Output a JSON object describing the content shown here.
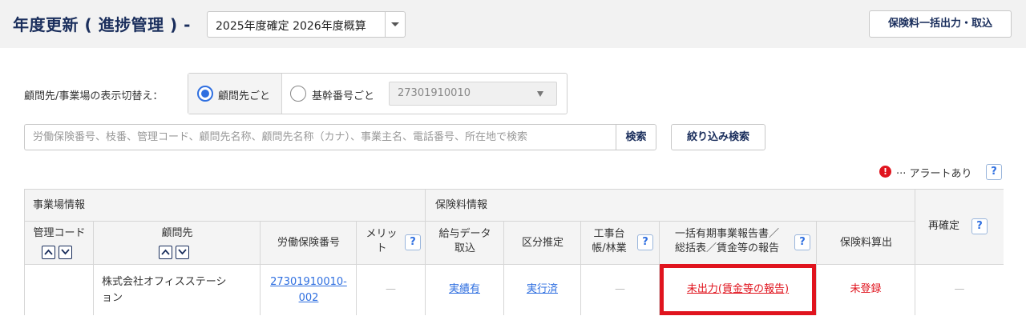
{
  "header": {
    "title": "年度更新 ( 進捗管理 ) -",
    "year_select_value": "2025年度確定 2026年度概算",
    "bulk_button": "保険料一括出力・取込"
  },
  "display_switch": {
    "label": "顧問先/事業場の表示切替え：",
    "option_client": "顧問先ごと",
    "option_base_number": "基幹番号ごと",
    "base_number_value": "27301910010"
  },
  "search": {
    "placeholder": "労働保険番号、枝番、管理コード、顧問先名称、顧問先名称（カナ）、事業主名、電話番号、所在地で検索",
    "search_button": "検索",
    "filter_button": "絞り込み検索"
  },
  "alert_legend": {
    "icon": "!",
    "text": "··· アラートあり",
    "help": "?"
  },
  "table": {
    "group_headers": {
      "office_info": "事業場情報",
      "premium_info": "保険料情報",
      "reconfirm": "再確定"
    },
    "columns": {
      "admin_code": "管理コード",
      "client": "顧問先",
      "labor_insurance_no": "労働保険番号",
      "merit_1": "メリッ",
      "merit_2": "ト",
      "salary_data_1": "給与データ",
      "salary_data_2": "取込",
      "category_estimate": "区分推定",
      "construction_1": "工事台",
      "construction_2": "帳/林業",
      "report_1": "一括有期事業報告書／",
      "report_2": "総括表／賃金等の報告",
      "premium_calc": "保険料算出"
    },
    "row": {
      "admin_code": "",
      "client_1": "株式会社オフィスステーシ",
      "client_2": "ョン",
      "labor_insurance_no_1": "27301910010-",
      "labor_insurance_no_2": "002",
      "merit": "—",
      "salary_data": "実績有",
      "category_estimate": "実行済",
      "construction": "—",
      "report": "未出力(賃金等の報告)",
      "premium_calc": "未登録",
      "reconfirm": "—"
    }
  },
  "colors": {
    "navy": "#1a2e5c",
    "link": "#2f6fe0",
    "alert_red": "#e0141e"
  }
}
